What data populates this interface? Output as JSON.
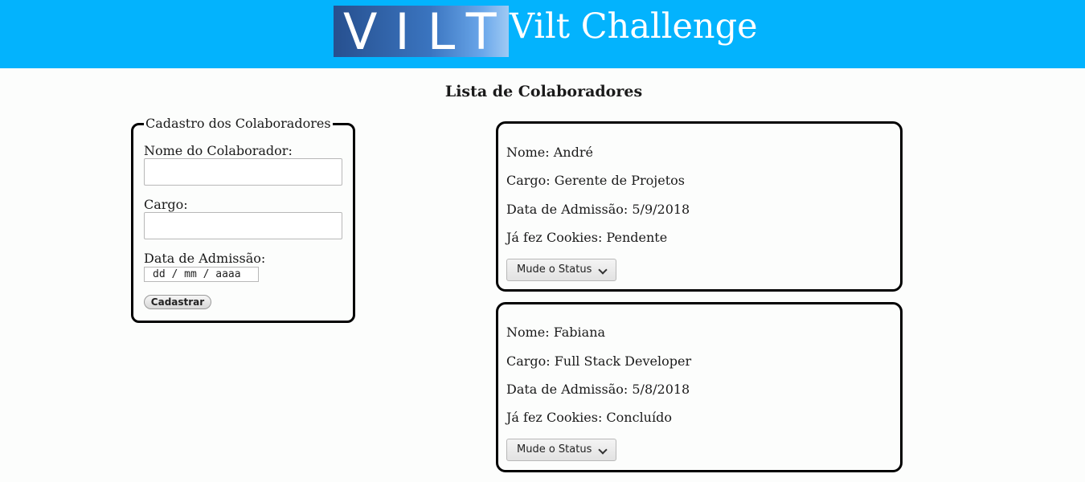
{
  "header": {
    "logo_text": "VILT",
    "title": "Vilt Challenge",
    "bg_color": "#03b3fd"
  },
  "form": {
    "legend": "Cadastro dos Colaboradores",
    "name_label": "Nome do Colaborador:",
    "name_value": "",
    "role_label": "Cargo:",
    "role_value": "",
    "date_label": "Data de Admissão:",
    "date_placeholder": "dd / mm / aaaa",
    "submit_label": "Cadastrar"
  },
  "list": {
    "heading": "Lista de Colaboradores",
    "select_label": "Mude o Status",
    "collaborators": [
      {
        "name": "Nome: André",
        "role": "Cargo: Gerente de Projetos",
        "admission": "Data de Admissão: 5/9/2018",
        "cookies": "Já fez Cookies: Pendente"
      },
      {
        "name": "Nome: Fabiana",
        "role": "Cargo: Full Stack Developer",
        "admission": "Data de Admissão: 5/8/2018",
        "cookies": "Já fez Cookies: Concluído"
      }
    ]
  }
}
